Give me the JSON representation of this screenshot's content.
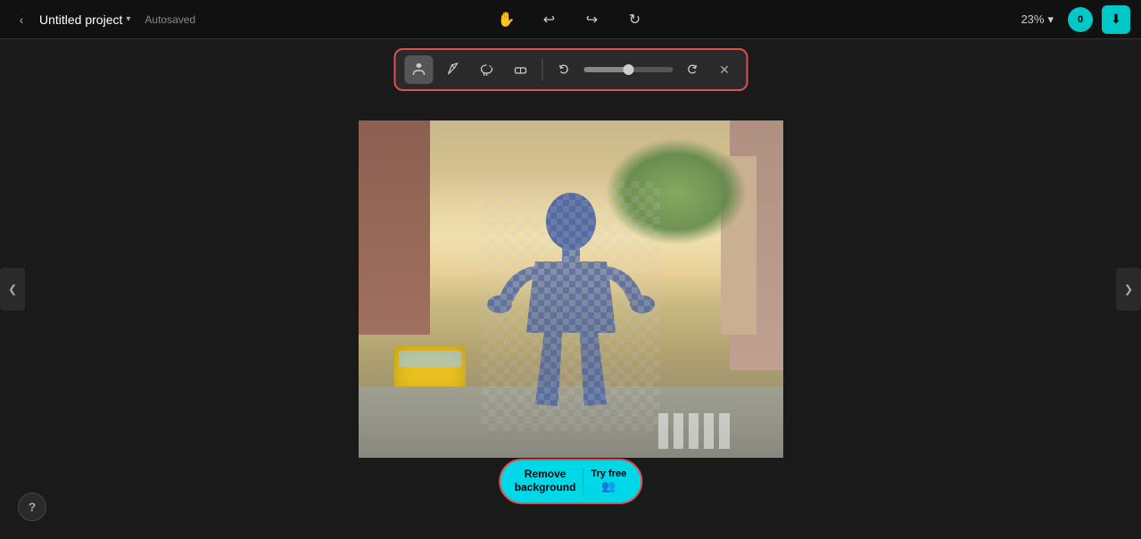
{
  "topbar": {
    "back_icon": "‹",
    "project_title": "Untitled project",
    "title_chevron": "▾",
    "autosaved": "Autosaved",
    "pan_icon": "✋",
    "undo_icon": "↩",
    "redo_left_icon": "↪",
    "redo_right_icon": "↻",
    "zoom_level": "23%",
    "zoom_chevron": "▾",
    "notifications_count": "0",
    "download_icon": "⬇"
  },
  "toolbar": {
    "select_icon": "👤",
    "pen_icon": "✏",
    "lasso_icon": "⊙",
    "eraser_icon": "◎",
    "undo_tool_icon": "↩",
    "redo_tool_icon": "↪",
    "close_icon": "✕"
  },
  "canvas": {
    "left_arrow": "❮",
    "right_arrow": "❯"
  },
  "remove_bg": {
    "main_text": "Remove\nbackground",
    "try_free_label": "Try free",
    "try_free_icon": "👥"
  },
  "help": {
    "icon": "?"
  }
}
